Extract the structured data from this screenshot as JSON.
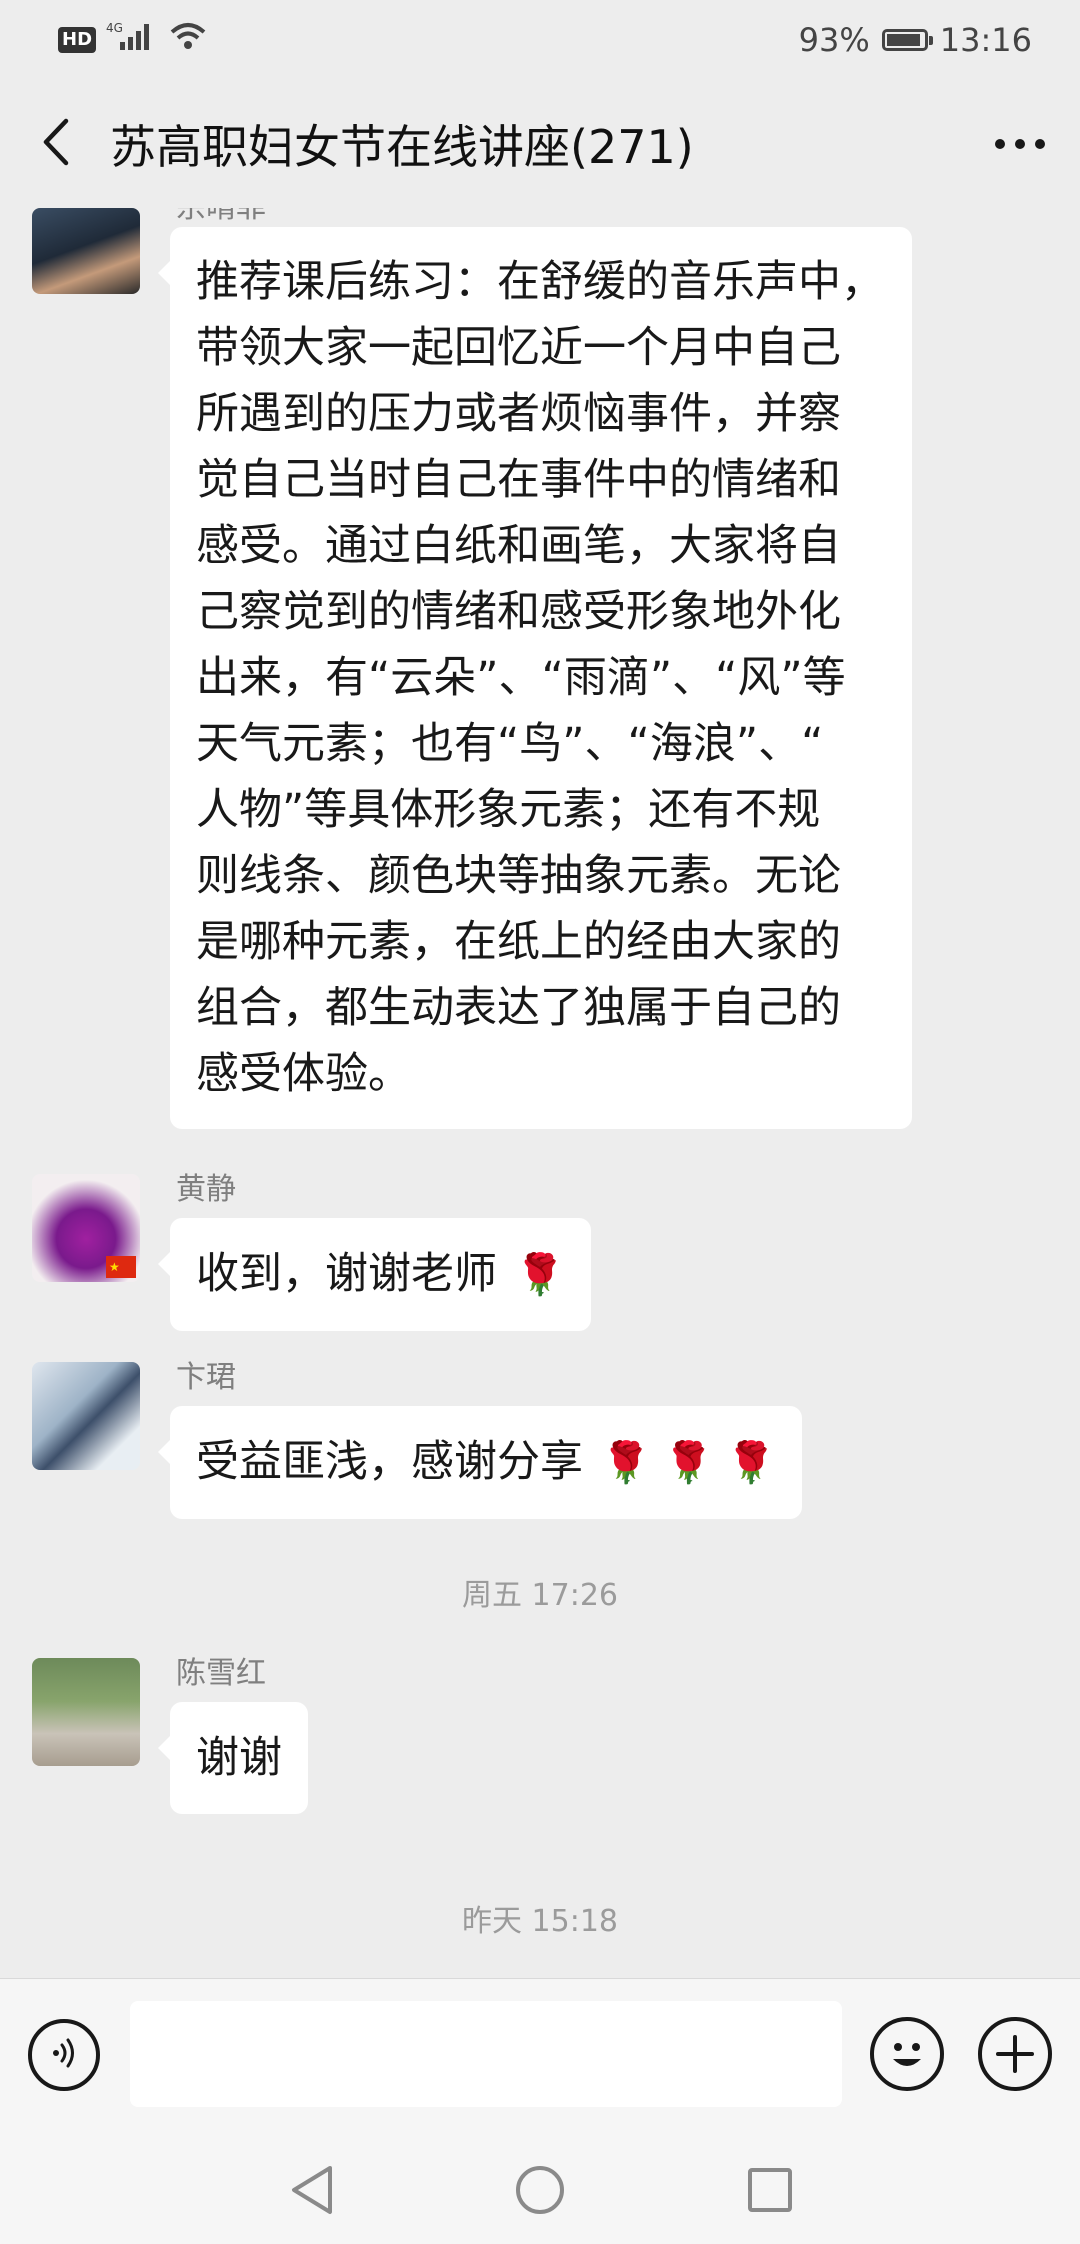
{
  "status_bar": {
    "network_badge": "HD",
    "network_type": "4G",
    "battery_percent": "93%",
    "battery_level": 0.93,
    "time": "13:16"
  },
  "header": {
    "title": "苏高职妇女节在线讲座(271)"
  },
  "messages": [
    {
      "sender": "宗晴菲",
      "lines": [
        "推荐课后练习：在舒缓的音乐声中，",
        "带领大家一起回忆近一个月中自己",
        "所遇到的压力或者烦恼事件，并察",
        "觉自己当时自己在事件中的情绪和",
        "感受。通过白纸和画笔，大家将自",
        "己察觉到的情绪和感受形象地外化",
        "出来，有“云朵”、“雨滴”、“风”等",
        "天气元素；也有“鸟”、“海浪”、“",
        "人物”等具体形象元素；还有不规",
        "则线条、颜色块等抽象元素。无论",
        "是哪种元素，在纸上的经由大家的",
        "组合，都生动表达了独属于自己的",
        "感受体验。"
      ]
    },
    {
      "sender": "黄静",
      "text": "收到，谢谢老师",
      "emoji": "🌹"
    },
    {
      "sender": "卞珺",
      "text": "受益匪浅，感谢分享",
      "emoji": "🌹 🌹 🌹"
    },
    {
      "sender": "陈雪红",
      "text": "谢谢"
    }
  ],
  "timestamps": [
    "周五 17:26",
    "昨天 15:18"
  ],
  "input": {
    "placeholder": ""
  },
  "icons": {
    "back": "back-arrow-icon",
    "more": "more-dots-icon",
    "voice": "voice-icon",
    "emoji": "emoji-icon",
    "plus": "plus-icon",
    "nav_back": "triangle-back-icon",
    "nav_home": "circle-home-icon",
    "nav_recent": "square-recent-icon"
  },
  "colors": {
    "background": "#ededed",
    "bubble": "#ffffff",
    "sender_name": "#7f7f7f"
  }
}
